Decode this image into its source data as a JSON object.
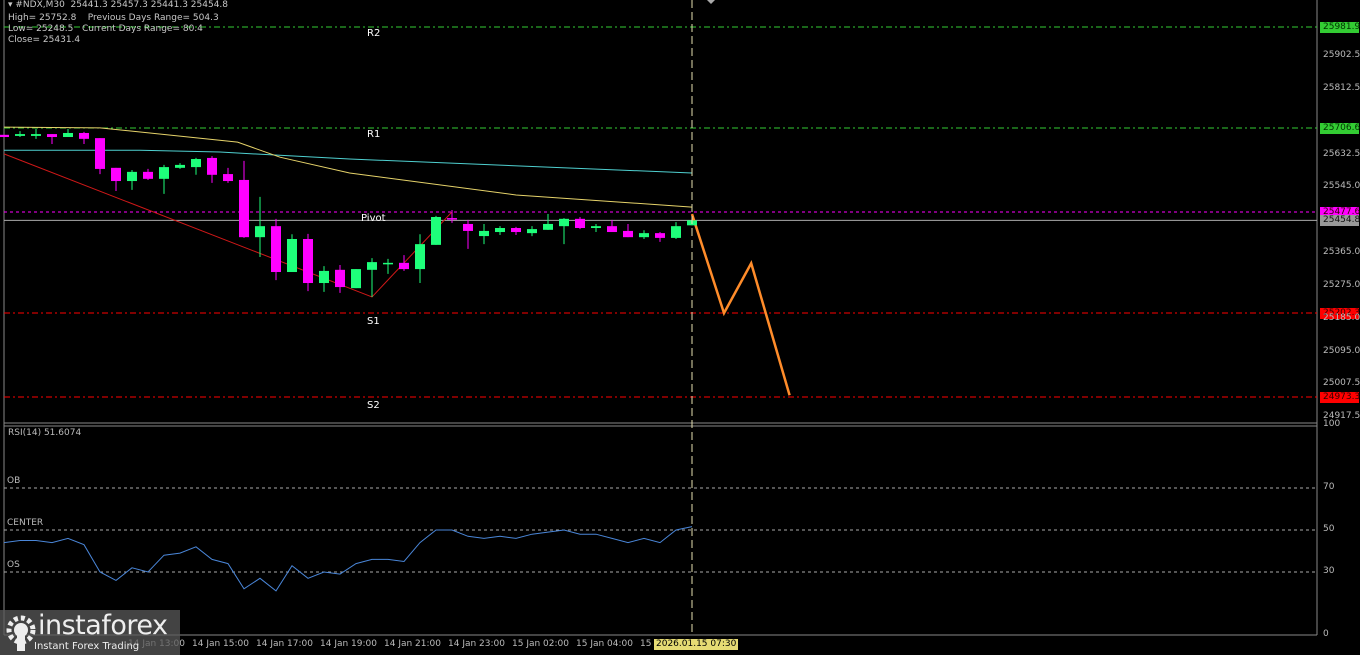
{
  "header": {
    "symbol_line": "#NDX,M30  25441.3 25457.3 25441.3 25454.8",
    "high": "High= 25752.8",
    "prev_range": "Previous Days Range= 504.3",
    "low": "Low= 25248.5",
    "cur_range": "Current Days Range= 80.4",
    "close": "Close= 25431.4"
  },
  "colors": {
    "bull": "#1eff7a",
    "bear": "#ff00ff",
    "ma_slow": "#e6d36a",
    "ma_fast": "#4fd0d0",
    "trend": "#d01818",
    "forecast": "#ff8c2a",
    "rsi": "#4a86d8"
  },
  "chart_data": [
    {
      "type": "candlestick",
      "title": "#NDX,M30",
      "yrange": [
        24917.5,
        25990
      ],
      "levels": [
        {
          "name": "R2",
          "value": 25981.9,
          "label": "25981.9",
          "color": "#33cc33"
        },
        {
          "name": "R1",
          "value": 25706.6,
          "label": "25706.6",
          "color": "#33cc33"
        },
        {
          "name": "Pivot",
          "value": 25477.6,
          "label": "25477.6",
          "color": "#ff00ff"
        },
        {
          "name": "S1",
          "value": 25202.3,
          "label": "25202.3",
          "color": "#ff0000"
        },
        {
          "name": "S2",
          "value": 24973.3,
          "label": "24973.3",
          "color": "#ff0000"
        }
      ],
      "current_price": {
        "value": 25454.8,
        "label": "25454.8"
      },
      "y_ticks": [
        {
          "v": 25902.5,
          "label": "25902.5"
        },
        {
          "v": 25812.5,
          "label": "25812.5"
        },
        {
          "v": 25632.5,
          "label": "25632.5"
        },
        {
          "v": 25545.0,
          "label": "25545.0"
        },
        {
          "v": 25365.0,
          "label": "25365.0"
        },
        {
          "v": 25275.0,
          "label": "25275.0"
        },
        {
          "v": 25185.0,
          "label": "25185.0"
        },
        {
          "v": 25095.0,
          "label": "25095.0"
        },
        {
          "v": 25007.5,
          "label": "25007.5"
        },
        {
          "v": 24917.5,
          "label": "24917.5"
        }
      ],
      "x_ticks": [
        {
          "i": 8,
          "label": "14 Jan 13:00"
        },
        {
          "i": 12,
          "label": "14 Jan 15:00"
        },
        {
          "i": 16,
          "label": "14 Jan 17:00"
        },
        {
          "i": 20,
          "label": "14 Jan 19:00"
        },
        {
          "i": 24,
          "label": "14 Jan 21:00"
        },
        {
          "i": 28,
          "label": "14 Jan 23:00"
        },
        {
          "i": 32,
          "label": "15 Jan 02:00"
        },
        {
          "i": 36,
          "label": "15 Jan 04:00"
        },
        {
          "i": 40,
          "label": "15"
        }
      ],
      "cursor_time": "2026.01.15 07:30",
      "ohlc": [
        [
          25688,
          25688,
          25682,
          25682
        ],
        [
          25685,
          25698,
          25682,
          25690
        ],
        [
          25685,
          25704,
          25677,
          25690
        ],
        [
          25690,
          25690,
          25663,
          25682
        ],
        [
          25682,
          25704,
          25682,
          25693
        ],
        [
          25693,
          25696,
          25663,
          25677
        ],
        [
          25679,
          25679,
          25581,
          25595
        ],
        [
          25598,
          25598,
          25535,
          25562
        ],
        [
          25562,
          25592,
          25538,
          25587
        ],
        [
          25587,
          25595,
          25565,
          25568
        ],
        [
          25568,
          25606,
          25527,
          25600
        ],
        [
          25598,
          25611,
          25595,
          25606
        ],
        [
          25600,
          25625,
          25579,
          25622
        ],
        [
          25625,
          25630,
          25557,
          25579
        ],
        [
          25581,
          25598,
          25557,
          25562
        ],
        [
          25565,
          25617,
          25407,
          25409
        ],
        [
          25409,
          25519,
          25355,
          25439
        ],
        [
          25439,
          25459,
          25292,
          25314
        ],
        [
          25314,
          25417,
          25314,
          25404
        ],
        [
          25404,
          25418,
          25262,
          25284
        ],
        [
          25284,
          25330,
          25260,
          25317
        ],
        [
          25320,
          25333,
          25257,
          25273
        ],
        [
          25270,
          25322,
          25270,
          25322
        ],
        [
          25320,
          25352,
          25246,
          25341
        ],
        [
          25336,
          25350,
          25309,
          25339
        ],
        [
          25339,
          25360,
          25317,
          25322
        ],
        [
          25322,
          25417,
          25284,
          25390
        ],
        [
          25388,
          25467,
          25388,
          25464
        ],
        [
          25461,
          25483,
          25448,
          25459
        ],
        [
          25445,
          25456,
          25377,
          25426
        ],
        [
          25412,
          25445,
          25390,
          25426
        ],
        [
          25423,
          25439,
          25415,
          25434
        ],
        [
          25434,
          25437,
          25415,
          25423
        ],
        [
          25420,
          25439,
          25412,
          25431
        ],
        [
          25429,
          25472,
          25429,
          25445
        ],
        [
          25439,
          25461,
          25390,
          25459
        ],
        [
          25459,
          25464,
          25431,
          25434
        ],
        [
          25434,
          25445,
          25423,
          25439
        ],
        [
          25439,
          25456,
          25423,
          25423
        ],
        [
          25426,
          25445,
          25409,
          25409
        ],
        [
          25409,
          25428,
          25404,
          25420
        ],
        [
          25420,
          25423,
          25396,
          25407
        ],
        [
          25407,
          25450,
          25404,
          25439
        ],
        [
          25441.3,
          25457.3,
          25441.3,
          25454.8
        ]
      ],
      "ma_slow": [
        [
          0,
          25709
        ],
        [
          6,
          25707
        ],
        [
          14.6,
          25668
        ],
        [
          17.25,
          25627
        ],
        [
          21.6,
          25584
        ],
        [
          32,
          25524
        ],
        [
          43,
          25491
        ]
      ],
      "ma_fast": [
        [
          0,
          25646
        ],
        [
          8.5,
          25646
        ],
        [
          13.5,
          25641
        ],
        [
          21.6,
          25622
        ],
        [
          43,
          25584
        ]
      ],
      "trendline": [
        [
          0,
          25636
        ],
        [
          23,
          25246
        ],
        [
          28,
          25478
        ]
      ],
      "forecast": [
        [
          43,
          25472
        ],
        [
          45,
          25202
        ],
        [
          46.7,
          25338
        ],
        [
          49.1,
          24978
        ]
      ]
    },
    {
      "type": "line",
      "title": "RSI(14) 51.6074",
      "yrange": [
        0,
        100
      ],
      "y_ticks": [
        {
          "v": 100,
          "label": "100"
        },
        {
          "v": 70,
          "label": "70"
        },
        {
          "v": 50,
          "label": "50"
        },
        {
          "v": 30,
          "label": "30"
        },
        {
          "v": 0,
          "label": "0"
        }
      ],
      "levels": [
        {
          "v": 70,
          "label": "OB"
        },
        {
          "v": 50,
          "label": "CENTER"
        },
        {
          "v": 30,
          "label": "OS"
        }
      ],
      "values": [
        44,
        45,
        45,
        44,
        46,
        43,
        30,
        26,
        32,
        30,
        38,
        39,
        42,
        36,
        34,
        22,
        27,
        21,
        33,
        27,
        30,
        29,
        34,
        36,
        36,
        35,
        44,
        50,
        50,
        47,
        46,
        47,
        46,
        48,
        49,
        50,
        48,
        48,
        46,
        44,
        46,
        44,
        50,
        51.6
      ]
    }
  ],
  "logo": {
    "name": "instaforex",
    "tagline": "Instant Forex Trading"
  }
}
